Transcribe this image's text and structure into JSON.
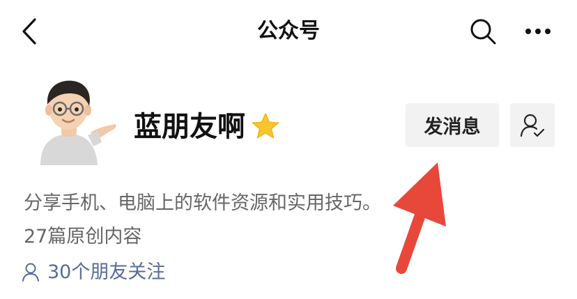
{
  "nav": {
    "title": "公众号",
    "back_icon": "chevron-left-icon",
    "search_icon": "search-icon",
    "more_icon": "more-horizontal-icon"
  },
  "account": {
    "name": "蓝朋友啊",
    "badge_icon": "star-icon",
    "badge_color": "#f7c52d",
    "avatar": "memoji-avatar",
    "send_message_label": "发消息",
    "follow_icon": "user-check-icon",
    "description": "分享手机、电脑上的软件资源和实用技巧。",
    "original_count": "27篇原创内容",
    "friends_following": "30个朋友关注",
    "friends_icon": "user-outline-icon",
    "link_color": "#576b95"
  },
  "annotation": {
    "arrow_color": "#e8483a"
  }
}
